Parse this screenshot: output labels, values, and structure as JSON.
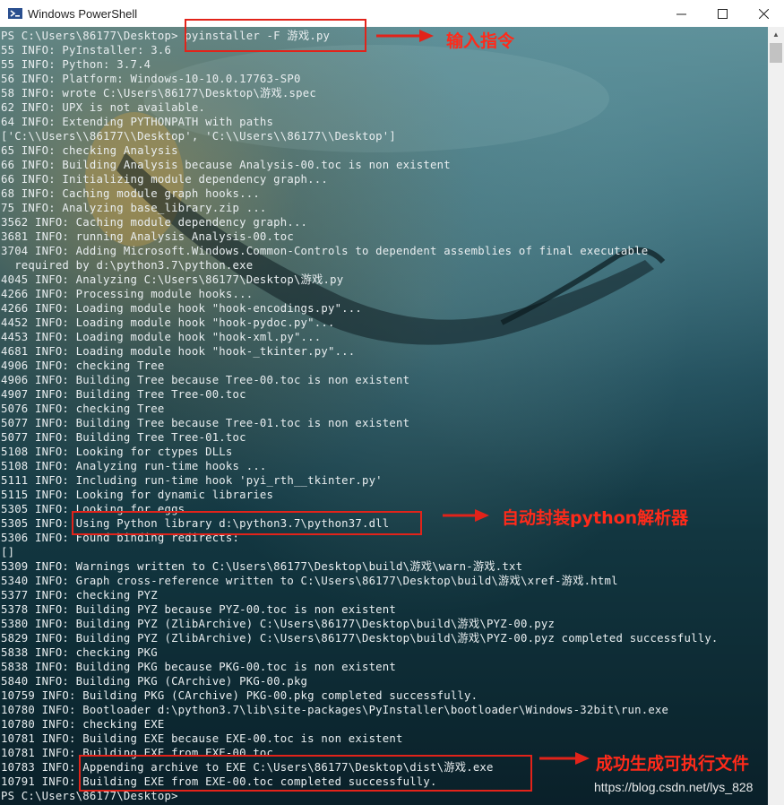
{
  "window": {
    "title": "Windows PowerShell",
    "controls": {
      "minimize": "—",
      "maximize": "☐",
      "close": "✕"
    },
    "icon": "powershell-icon"
  },
  "terminal_lines": [
    "PS C:\\Users\\86177\\Desktop> pyinstaller -F 游戏.py",
    "55 INFO: PyInstaller: 3.6",
    "55 INFO: Python: 3.7.4",
    "56 INFO: Platform: Windows-10-10.0.17763-SP0",
    "58 INFO: wrote C:\\Users\\86177\\Desktop\\游戏.spec",
    "62 INFO: UPX is not available.",
    "64 INFO: Extending PYTHONPATH with paths",
    "['C:\\\\Users\\\\86177\\\\Desktop', 'C:\\\\Users\\\\86177\\\\Desktop']",
    "65 INFO: checking Analysis",
    "66 INFO: Building Analysis because Analysis-00.toc is non existent",
    "66 INFO: Initializing module dependency graph...",
    "68 INFO: Caching module graph hooks...",
    "75 INFO: Analyzing base_library.zip ...",
    "3562 INFO: Caching module dependency graph...",
    "3681 INFO: running Analysis Analysis-00.toc",
    "3704 INFO: Adding Microsoft.Windows.Common-Controls to dependent assemblies of final executable",
    "  required by d:\\python3.7\\python.exe",
    "4045 INFO: Analyzing C:\\Users\\86177\\Desktop\\游戏.py",
    "4266 INFO: Processing module hooks...",
    "4266 INFO: Loading module hook \"hook-encodings.py\"...",
    "4452 INFO: Loading module hook \"hook-pydoc.py\"...",
    "4453 INFO: Loading module hook \"hook-xml.py\"...",
    "4681 INFO: Loading module hook \"hook-_tkinter.py\"...",
    "4906 INFO: checking Tree",
    "4906 INFO: Building Tree because Tree-00.toc is non existent",
    "4907 INFO: Building Tree Tree-00.toc",
    "5076 INFO: checking Tree",
    "5077 INFO: Building Tree because Tree-01.toc is non existent",
    "5077 INFO: Building Tree Tree-01.toc",
    "5108 INFO: Looking for ctypes DLLs",
    "5108 INFO: Analyzing run-time hooks ...",
    "5111 INFO: Including run-time hook 'pyi_rth__tkinter.py'",
    "5115 INFO: Looking for dynamic libraries",
    "5305 INFO: Looking for eggs",
    "5305 INFO: Using Python library d:\\python3.7\\python37.dll",
    "5306 INFO: Found binding redirects:",
    "[]",
    "5309 INFO: Warnings written to C:\\Users\\86177\\Desktop\\build\\游戏\\warn-游戏.txt",
    "5340 INFO: Graph cross-reference written to C:\\Users\\86177\\Desktop\\build\\游戏\\xref-游戏.html",
    "5377 INFO: checking PYZ",
    "5378 INFO: Building PYZ because PYZ-00.toc is non existent",
    "5380 INFO: Building PYZ (ZlibArchive) C:\\Users\\86177\\Desktop\\build\\游戏\\PYZ-00.pyz",
    "5829 INFO: Building PYZ (ZlibArchive) C:\\Users\\86177\\Desktop\\build\\游戏\\PYZ-00.pyz completed successfully.",
    "5838 INFO: checking PKG",
    "5838 INFO: Building PKG because PKG-00.toc is non existent",
    "5840 INFO: Building PKG (CArchive) PKG-00.pkg",
    "10759 INFO: Building PKG (CArchive) PKG-00.pkg completed successfully.",
    "10780 INFO: Bootloader d:\\python3.7\\lib\\site-packages\\PyInstaller\\bootloader\\Windows-32bit\\run.exe",
    "10780 INFO: checking EXE",
    "10781 INFO: Building EXE because EXE-00.toc is non existent",
    "10781 INFO: Building EXE from EXE-00.toc",
    "10783 INFO: Appending archive to EXE C:\\Users\\86177\\Desktop\\dist\\游戏.exe",
    "10791 INFO: Building EXE from EXE-00.toc completed successfully.",
    "PS C:\\Users\\86177\\Desktop>"
  ],
  "annotations": {
    "command": "输入指令",
    "library": "自动封装python解析器",
    "success": "成功生成可执行文件",
    "color": "#ff2a1a"
  },
  "watermark": "https://blog.csdn.net/lys_828"
}
